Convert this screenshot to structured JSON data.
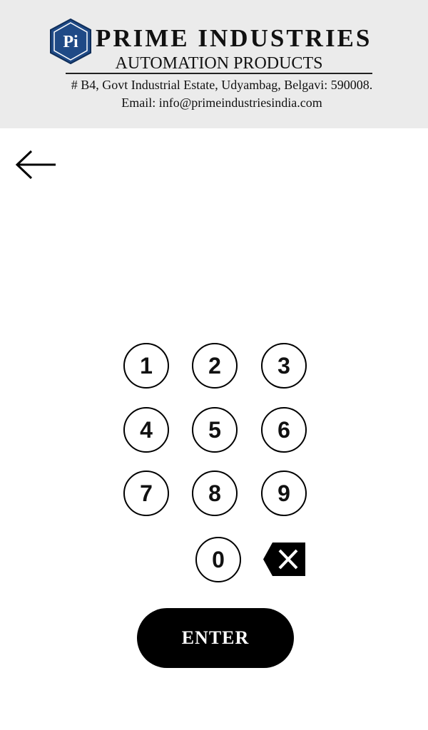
{
  "header": {
    "logo_text": "Pi",
    "company_name": "PRIME INDUSTRIES",
    "tagline": "AUTOMATION PRODUCTS",
    "address": "# B4, Govt Industrial Estate, Udyambag, Belgavi: 590008.",
    "email": "Email: info@primeindustriesindia.com",
    "logo_color": "#1f4a86"
  },
  "nav": {
    "back_icon": "arrow-left-icon"
  },
  "keypad": {
    "keys": [
      "1",
      "2",
      "3",
      "4",
      "5",
      "6",
      "7",
      "8",
      "9",
      "0"
    ],
    "backspace_icon": "backspace-icon"
  },
  "actions": {
    "enter_label": "ENTER"
  }
}
